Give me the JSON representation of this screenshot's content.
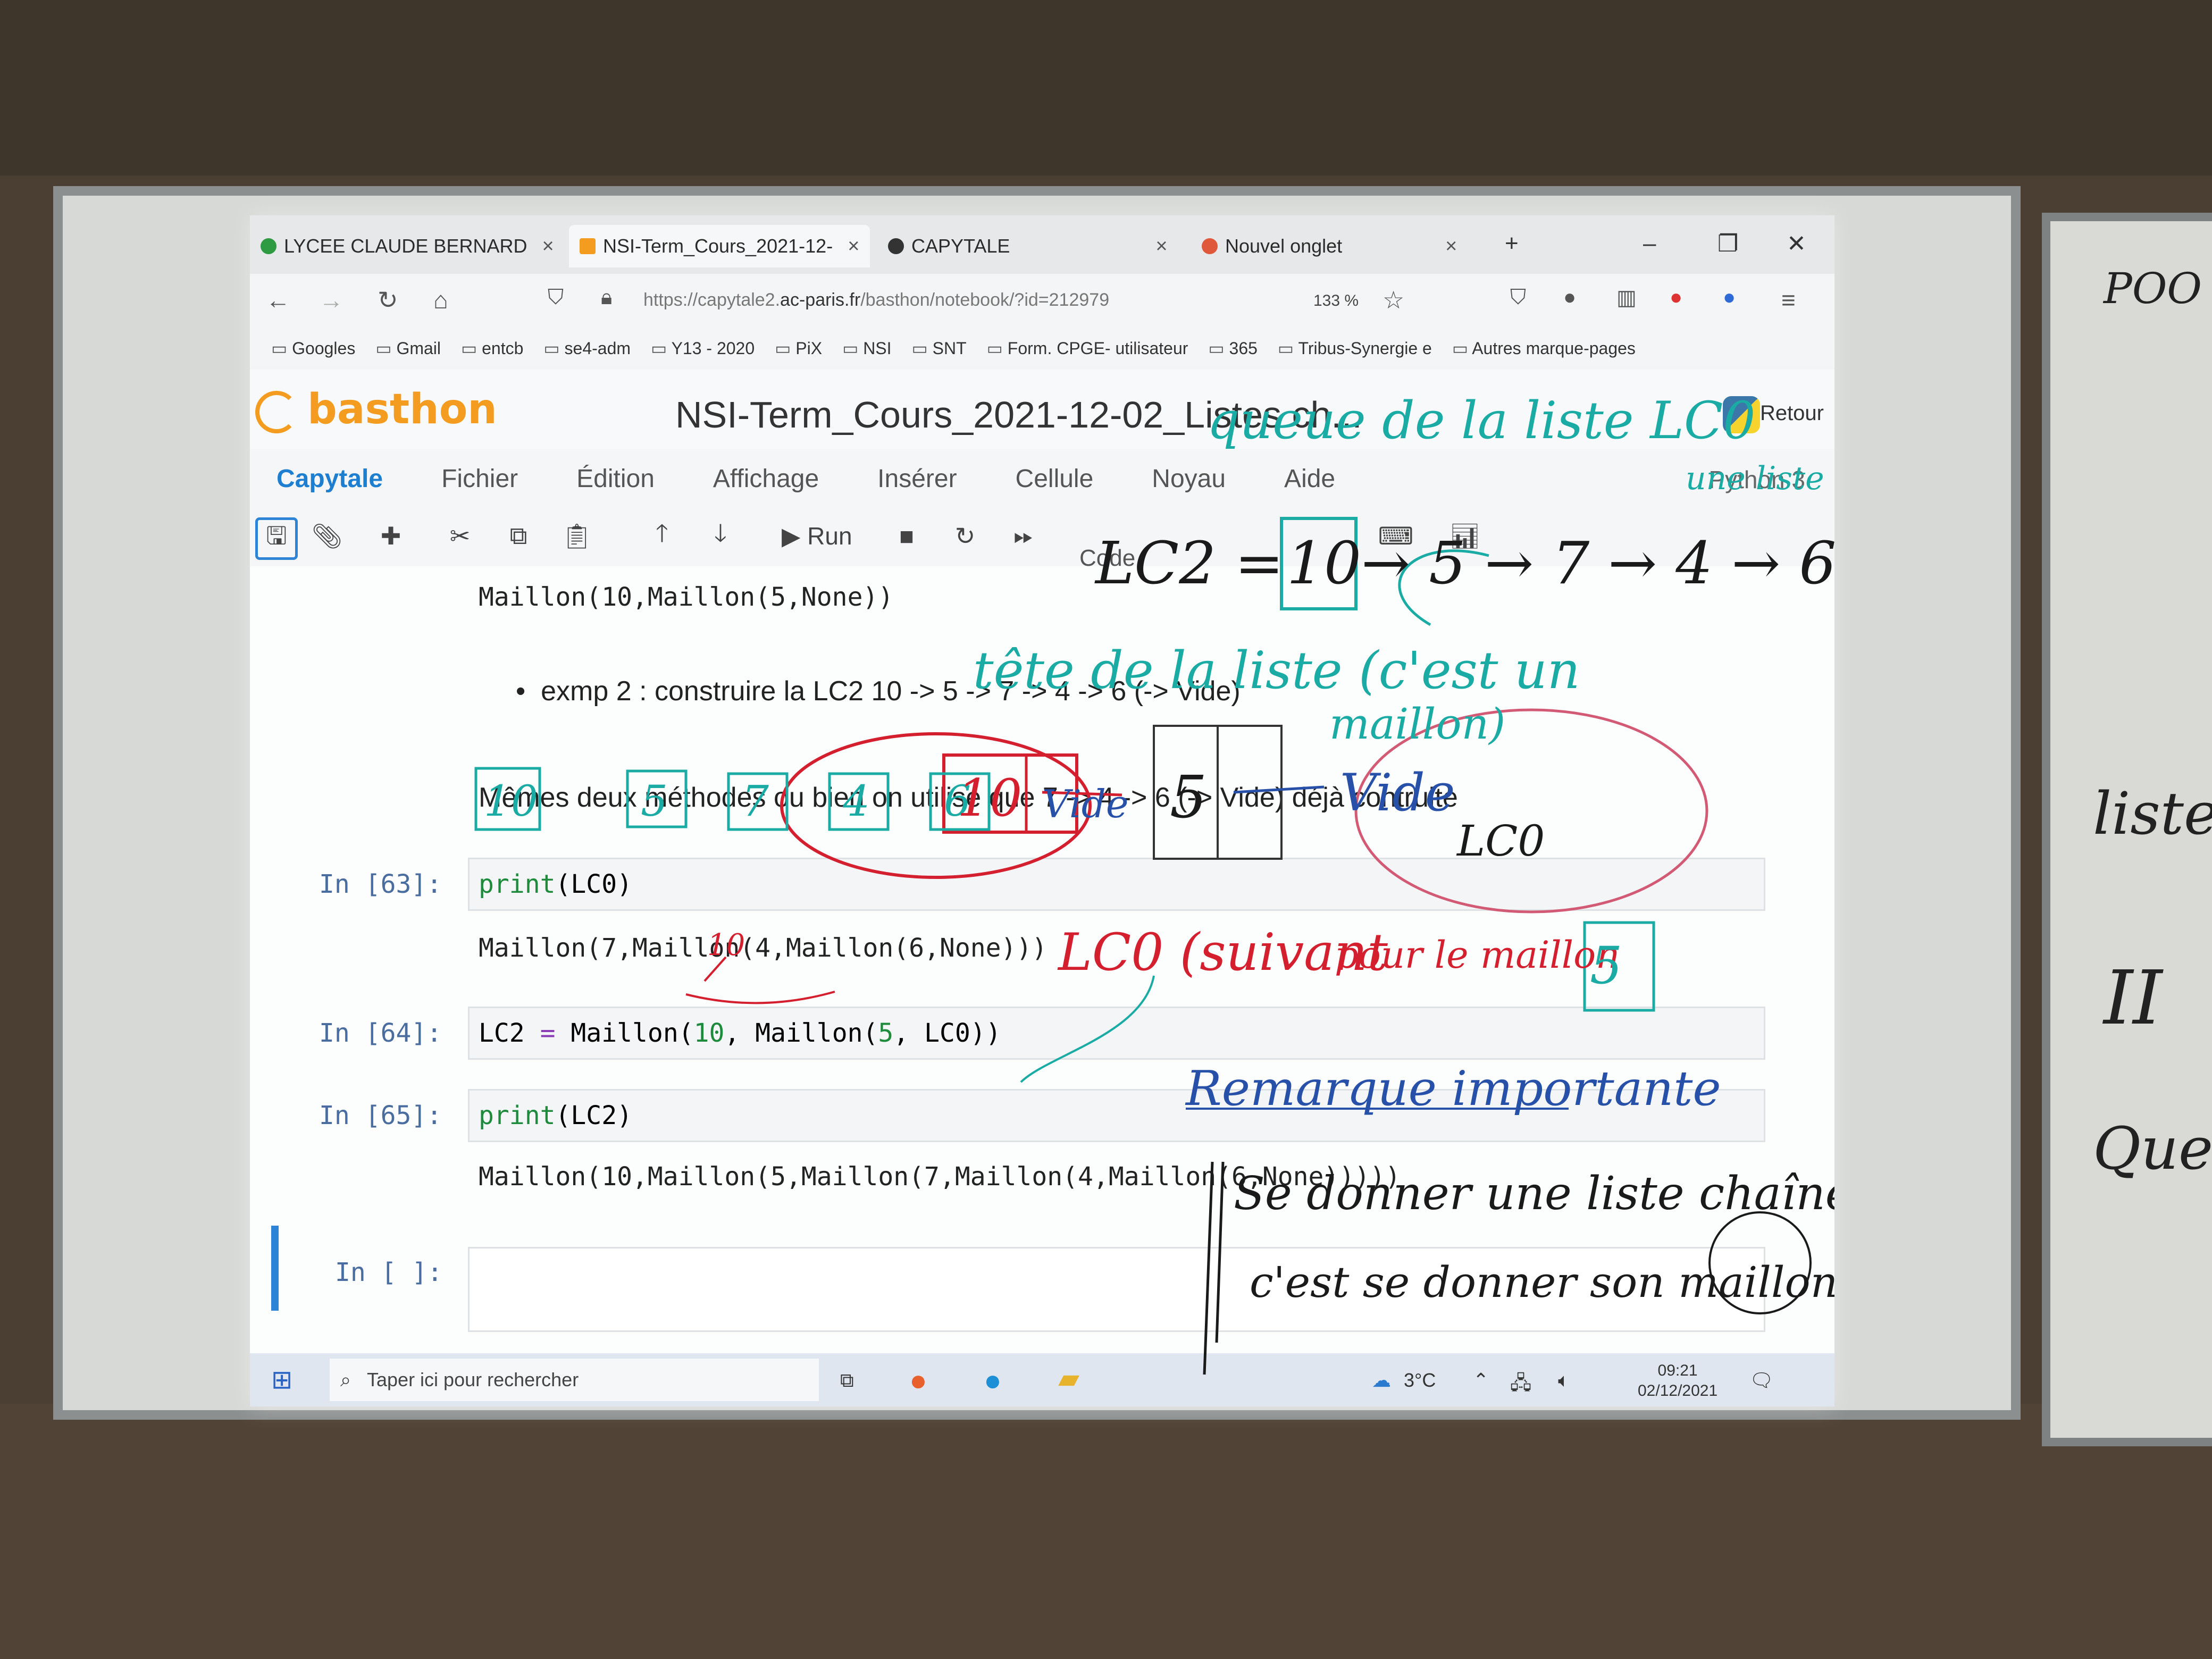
{
  "browser": {
    "tabs": [
      {
        "label": "LYCEE CLAUDE BERNARD",
        "close": "×"
      },
      {
        "label": "NSI-Term_Cours_2021-12-",
        "close": "×"
      },
      {
        "label": "CAPYTALE",
        "close": "×"
      },
      {
        "label": "Nouvel onglet",
        "close": "×"
      }
    ],
    "new_tab": "+",
    "url_prefix": "https://capytale2.",
    "url_domain": "ac-paris.fr",
    "url_rest": "/basthon/notebook/?id=212979",
    "zoom": "133 %",
    "bookmarks": [
      "Googles",
      "Gmail",
      "entcb",
      "se4-adm",
      "Y13 - 2020",
      "PiX",
      "NSI",
      "SNT",
      "Form. CPGE- utilisateur",
      "365",
      "Tribus-Synergie e",
      "Autres marque-pages"
    ]
  },
  "app": {
    "logo": "basthon",
    "title": "NSI-Term_Cours_2021-12-02_Listes ch...",
    "back_label": "Retour",
    "menu": [
      "Capytale",
      "Fichier",
      "Édition",
      "Affichage",
      "Insérer",
      "Cellule",
      "Noyau",
      "Aide"
    ],
    "kernel": "Python 3",
    "toolbar": {
      "run": "Run",
      "cell_type": "Code"
    }
  },
  "notebook": {
    "top_output": "Maillon(10,Maillon(5,None))",
    "bullet": "exmp 2 : construire la LC2 10 -> 5 -> 7 -> 4 -> 6 (-> Vide)",
    "note": "Mêmes deux méthodes ou bien on utilise que 7 -> 4 -> 6 (-> Vide) déjà contruite",
    "cells": [
      {
        "prompt": "In [63]:",
        "code_fn": "print",
        "code_arg": "(LC0)",
        "output": "Maillon(7,Maillon(4,Maillon(6,None)))"
      },
      {
        "prompt": "In [64]:",
        "code_var": "LC2",
        "code_eq": "=",
        "code_rest1": "Maillon(",
        "n1": "10",
        "code_rest2": ", Maillon(",
        "n2": "5",
        "code_rest3": ", LC0))"
      },
      {
        "prompt": "In [65]:",
        "code_fn": "print",
        "code_arg": "(LC2)",
        "output": "Maillon(10,Maillon(5,Maillon(7,Maillon(4,Maillon(6,None)))))"
      },
      {
        "prompt": "In [ ]:"
      }
    ]
  },
  "taskbar": {
    "search_placeholder": "Taper ici pour rechercher",
    "weather": "3°C",
    "time": "09:21",
    "date": "02/12/2021"
  },
  "handwriting": {
    "queue": "queue de la liste LC0",
    "une_liste": "une liste",
    "lc2_eq": "LC2 =",
    "lc2_head": "10",
    "lc2_chain": "→ 5 → 7 → 4 → 6",
    "tete": "tête de la liste (c'est un",
    "maillon": "maillon)",
    "chain_boxes": [
      "10",
      "5",
      "7",
      "4",
      "6"
    ],
    "vide": "Vide",
    "red_box": "10",
    "right_box": "5",
    "right_vide": "Vide",
    "right_lc0": "LC0",
    "lc0_suivant": "LC0 (suivant",
    "pour_le_maillon": "pour le maillon",
    "small_box": "5",
    "ten_over": "10",
    "remarque": "Remarque importante",
    "line1": "Se donner une liste chaînée",
    "line2": "c'est se donner son maillon de tête",
    "board_right": [
      "POO",
      "liste",
      "II",
      "Questi"
    ]
  },
  "colors": {
    "teal": "#1aaba4",
    "red": "#d41f2f",
    "blue": "#2750a8",
    "accent": "#1e7fd0"
  }
}
